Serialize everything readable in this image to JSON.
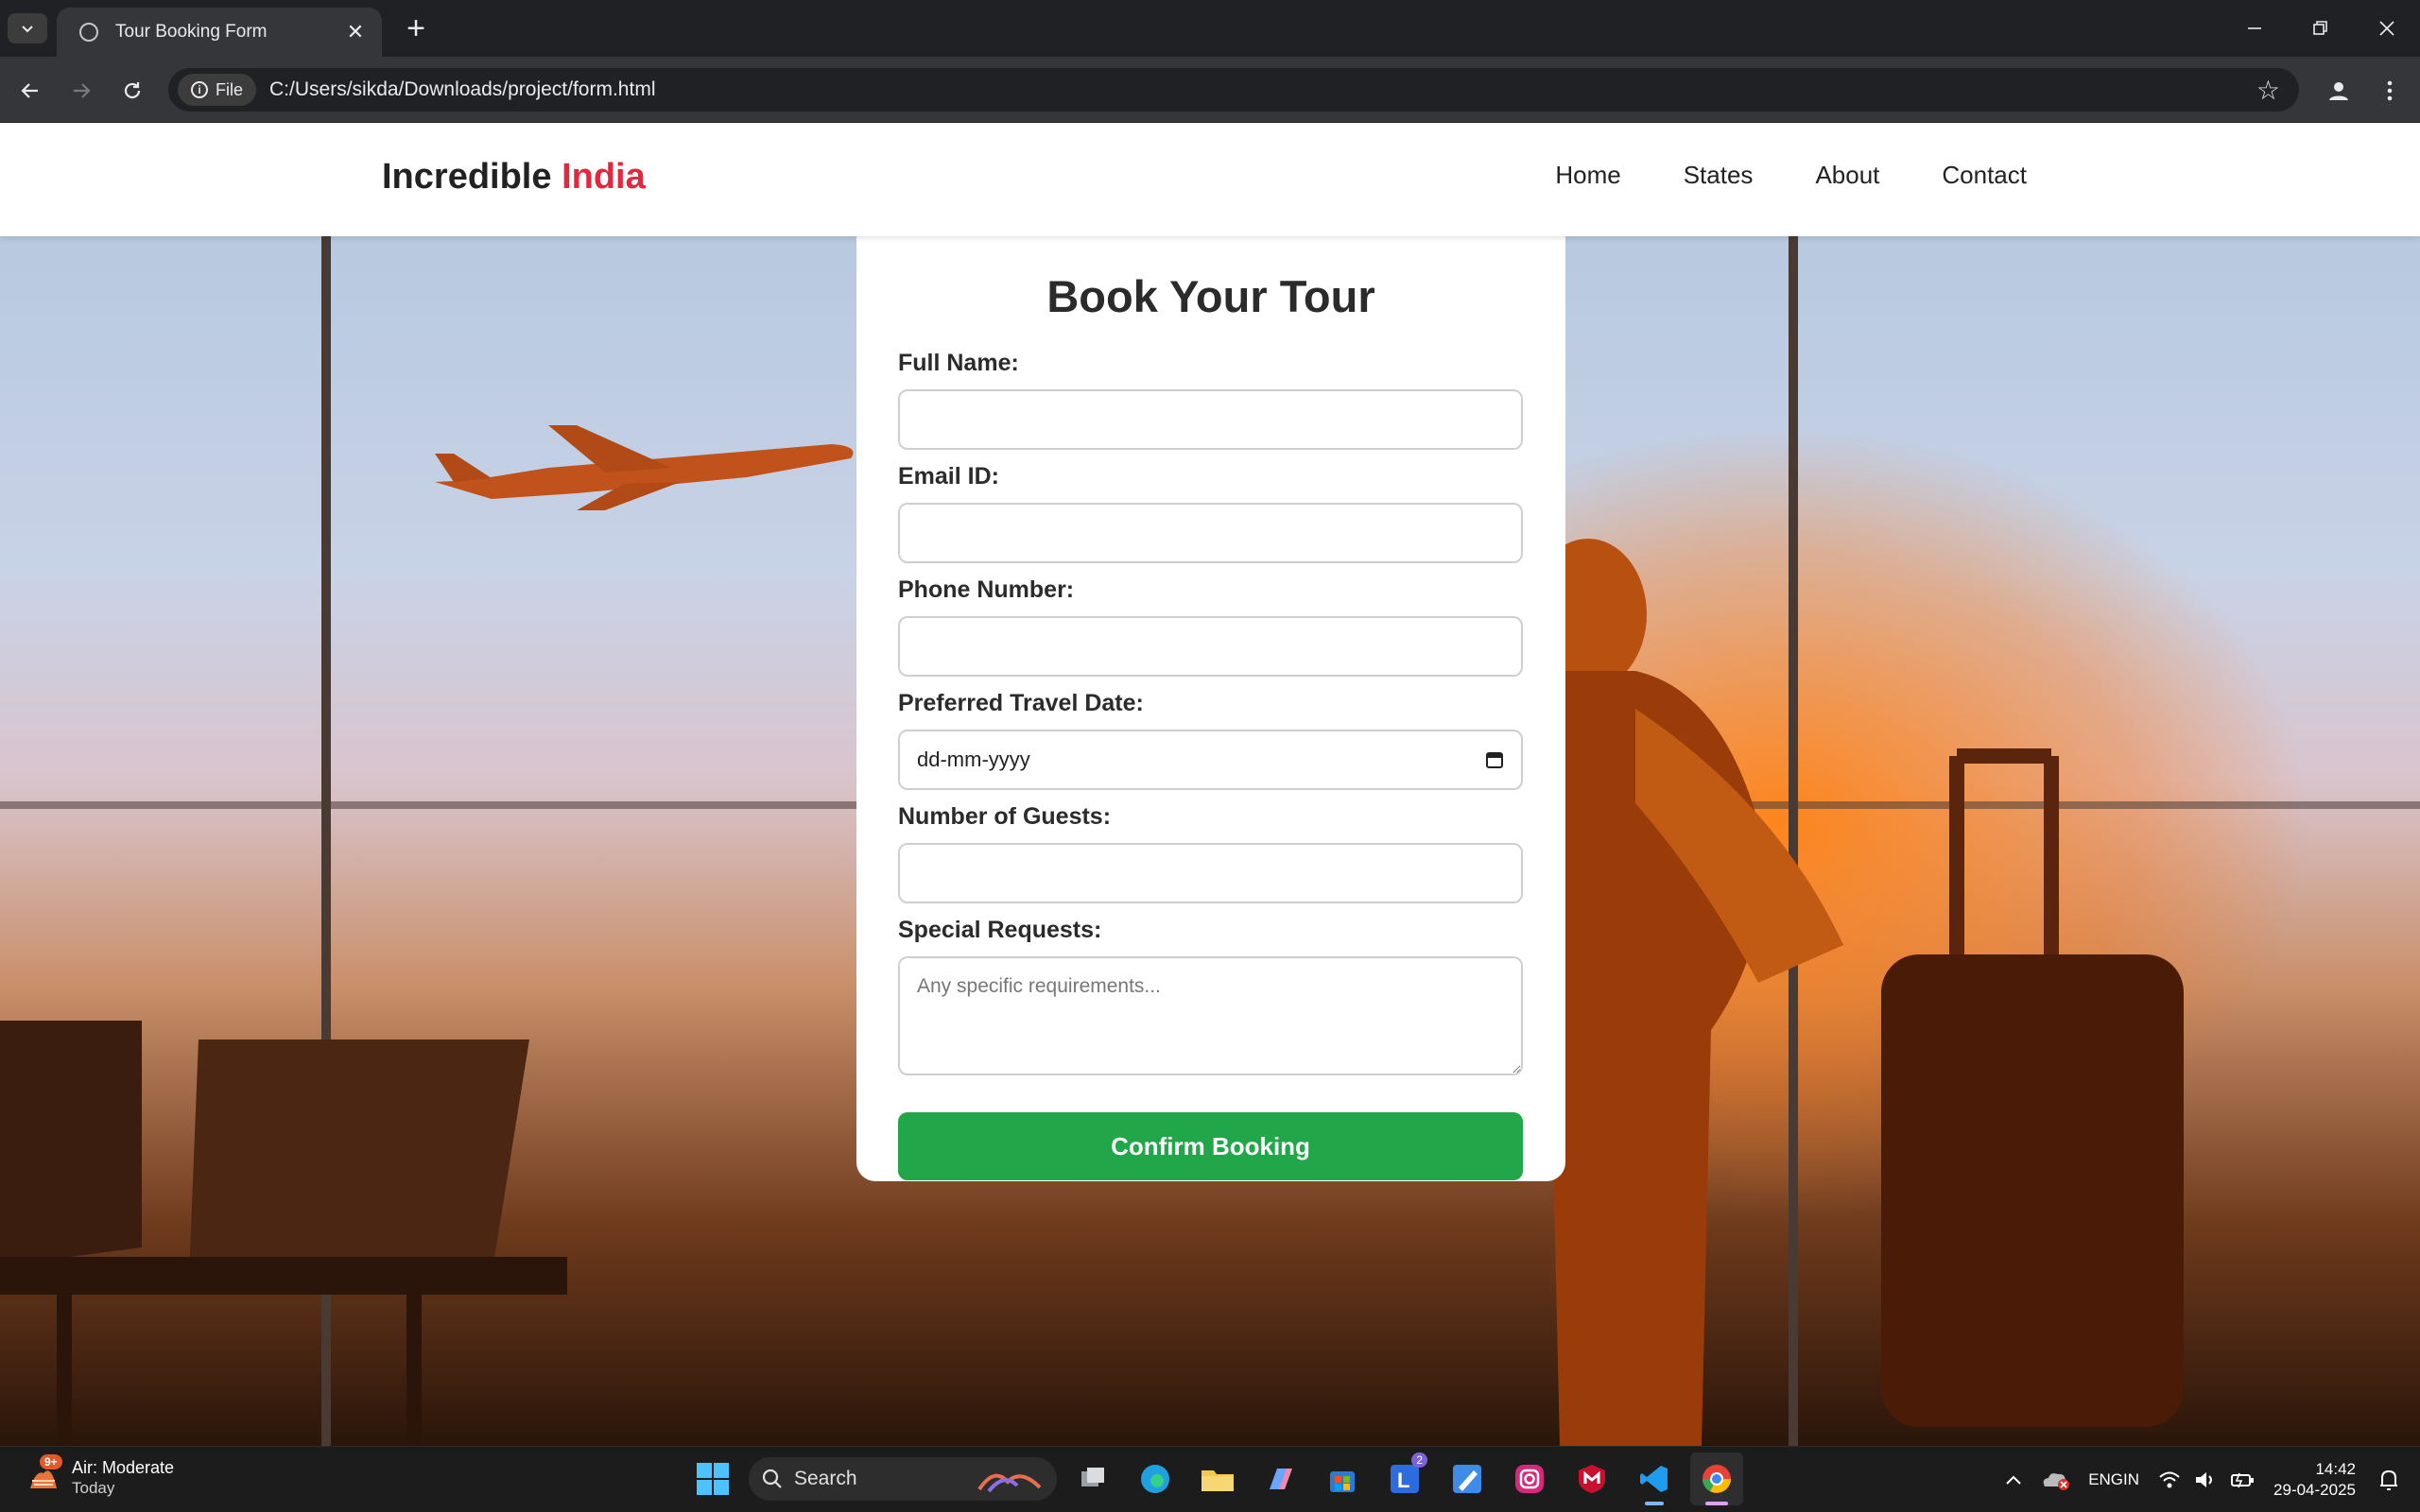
{
  "browser": {
    "tab_title": "Tour Booking Form",
    "chip_label": "File",
    "url": "C:/Users/sikda/Downloads/project/form.html"
  },
  "site": {
    "brand_main": "Incredible",
    "brand_accent": "India",
    "nav": [
      "Home",
      "States",
      "About",
      "Contact"
    ]
  },
  "form": {
    "title": "Book Your Tour",
    "fields": {
      "full_name": {
        "label": "Full Name:",
        "value": ""
      },
      "email": {
        "label": "Email ID:",
        "value": ""
      },
      "phone": {
        "label": "Phone Number:",
        "value": ""
      },
      "travel_date": {
        "label": "Preferred Travel Date:",
        "value": "dd-mm-yyyy"
      },
      "guests": {
        "label": "Number of Guests:",
        "value": ""
      },
      "requests": {
        "label": "Special Requests:",
        "placeholder": "Any specific requirements..."
      }
    },
    "submit_label": "Confirm Booking"
  },
  "colors": {
    "accent_red": "#e4273f",
    "submit_green": "#22a64a"
  },
  "taskbar": {
    "weather_title": "Air: Moderate",
    "weather_sub": "Today",
    "weather_badge": "9+",
    "search_label": "Search",
    "app_badge": "2",
    "lang_top": "ENG",
    "lang_bottom": "IN",
    "time": "14:42",
    "date": "29-04-2025"
  }
}
